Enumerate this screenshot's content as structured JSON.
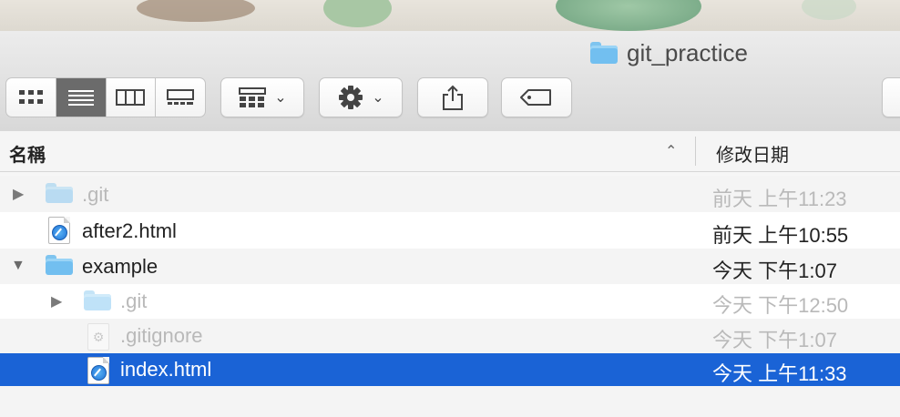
{
  "window": {
    "title": "git_practice"
  },
  "toolbar": {
    "view_buttons": [
      "icon-view",
      "list-view",
      "column-view",
      "gallery-view"
    ],
    "active_view": "list-view",
    "group_icon": "grid-icon",
    "action_icon": "gear-icon",
    "share_icon": "share-icon",
    "tag_icon": "tag-icon",
    "chevron": "⌄"
  },
  "columns": {
    "name": "名稱",
    "date_modified": "修改日期",
    "sort_indicator": "⌃"
  },
  "files": [
    {
      "name": ".git",
      "date": "前天 上午11:23",
      "kind": "folder",
      "disclosure": "▶",
      "dim": true
    },
    {
      "name": "after2.html",
      "date": "前天 上午10:55",
      "kind": "html",
      "disclosure": "",
      "dim": false
    },
    {
      "name": "example",
      "date": "今天 下午1:07",
      "kind": "folder",
      "disclosure": "▼",
      "dim": false
    },
    {
      "name": ".git",
      "date": "今天 下午12:50",
      "kind": "folder",
      "disclosure": "▶",
      "dim": true
    },
    {
      "name": ".gitignore",
      "date": "今天 下午1:07",
      "kind": "gear-doc",
      "disclosure": "",
      "dim": true
    },
    {
      "name": "index.html",
      "date": "今天 上午11:33",
      "kind": "html",
      "disclosure": "",
      "dim": false,
      "selected": true
    }
  ],
  "colors": {
    "selection": "#1a63d6",
    "folder": "#72bff0"
  }
}
